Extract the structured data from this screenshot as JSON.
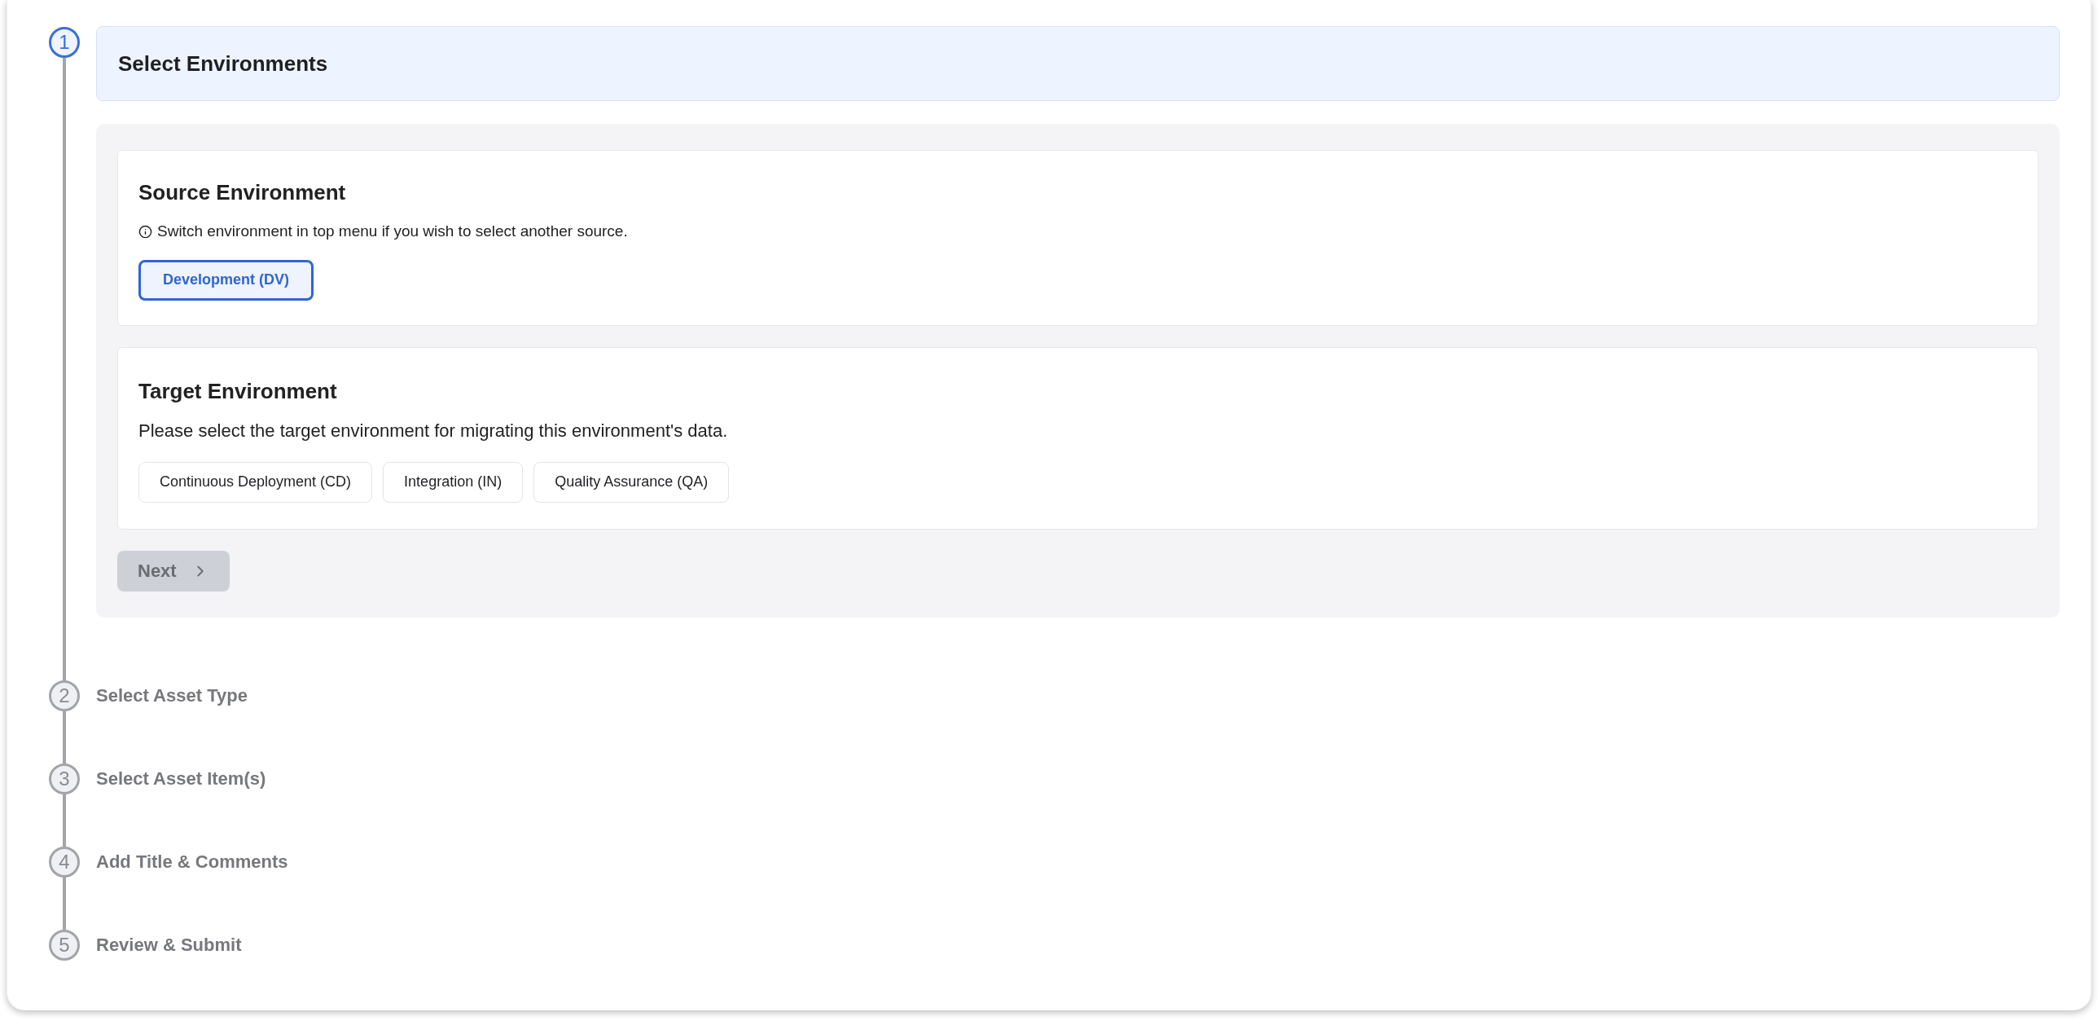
{
  "steps": [
    {
      "number": "1",
      "title": "Select Environments",
      "selected": true
    },
    {
      "number": "2",
      "title": "Select Asset Type",
      "selected": false
    },
    {
      "number": "3",
      "title": "Select Asset Item(s)",
      "selected": false
    },
    {
      "number": "4",
      "title": "Add Title & Comments",
      "selected": false
    },
    {
      "number": "5",
      "title": "Review & Submit",
      "selected": false
    }
  ],
  "source": {
    "title": "Source Environment",
    "note": "Switch environment in top menu if you wish to select another source.",
    "options": [
      {
        "label": "Development (DV)",
        "selected": true
      }
    ]
  },
  "target": {
    "title": "Target Environment",
    "description": "Please select the target environment for migrating this environment's data.",
    "options": [
      {
        "label": "Continuous Deployment (CD)",
        "selected": false
      },
      {
        "label": "Integration (IN)",
        "selected": false
      },
      {
        "label": "Quality Assurance (QA)",
        "selected": false
      }
    ]
  },
  "next_button": {
    "label": "Next",
    "disabled": true
  }
}
